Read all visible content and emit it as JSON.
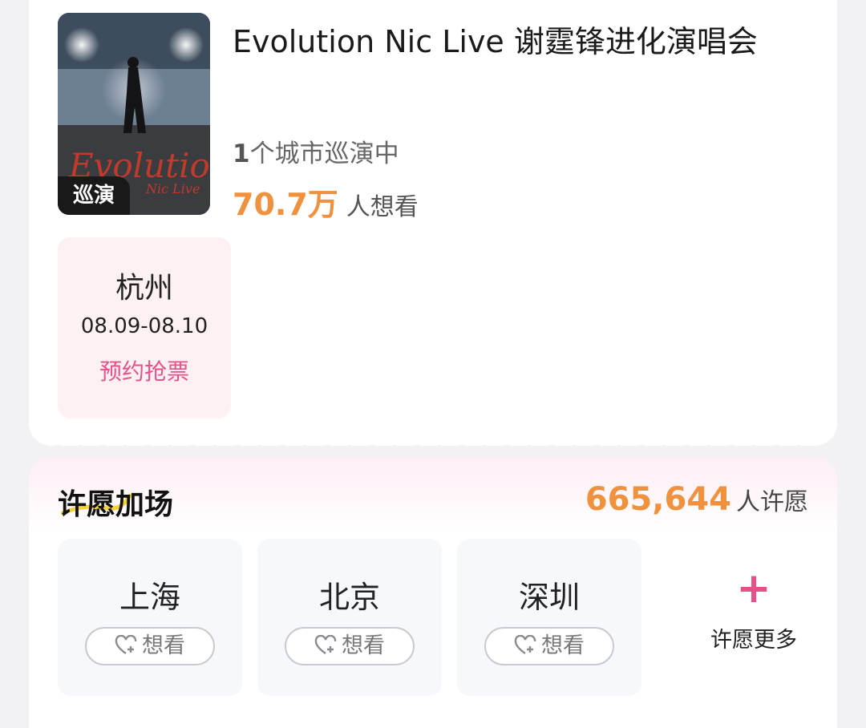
{
  "event": {
    "title": "Evolution Nic Live 谢霆锋进化演唱会",
    "badge": "巡演",
    "cities_count": "1",
    "cities_suffix": "个城市巡演中",
    "want_count": "70.7万",
    "want_label": "人想看"
  },
  "poster": {
    "script_text": "Evolution",
    "sub_text": "Nic Live"
  },
  "session": {
    "city": "杭州",
    "dates": "08.09-08.10",
    "action": "预约抢票"
  },
  "wish": {
    "title": "许愿加场",
    "count": "665,644",
    "count_label": "人许愿",
    "cities": [
      {
        "name": "上海",
        "button": "想看"
      },
      {
        "name": "北京",
        "button": "想看"
      },
      {
        "name": "深圳",
        "button": "想看"
      }
    ],
    "more_label": "许愿更多",
    "more_icon": "+"
  },
  "colors": {
    "accent_orange": "#f0913d",
    "accent_pink": "#e8508b",
    "card_pink": "#fdf1f1"
  }
}
